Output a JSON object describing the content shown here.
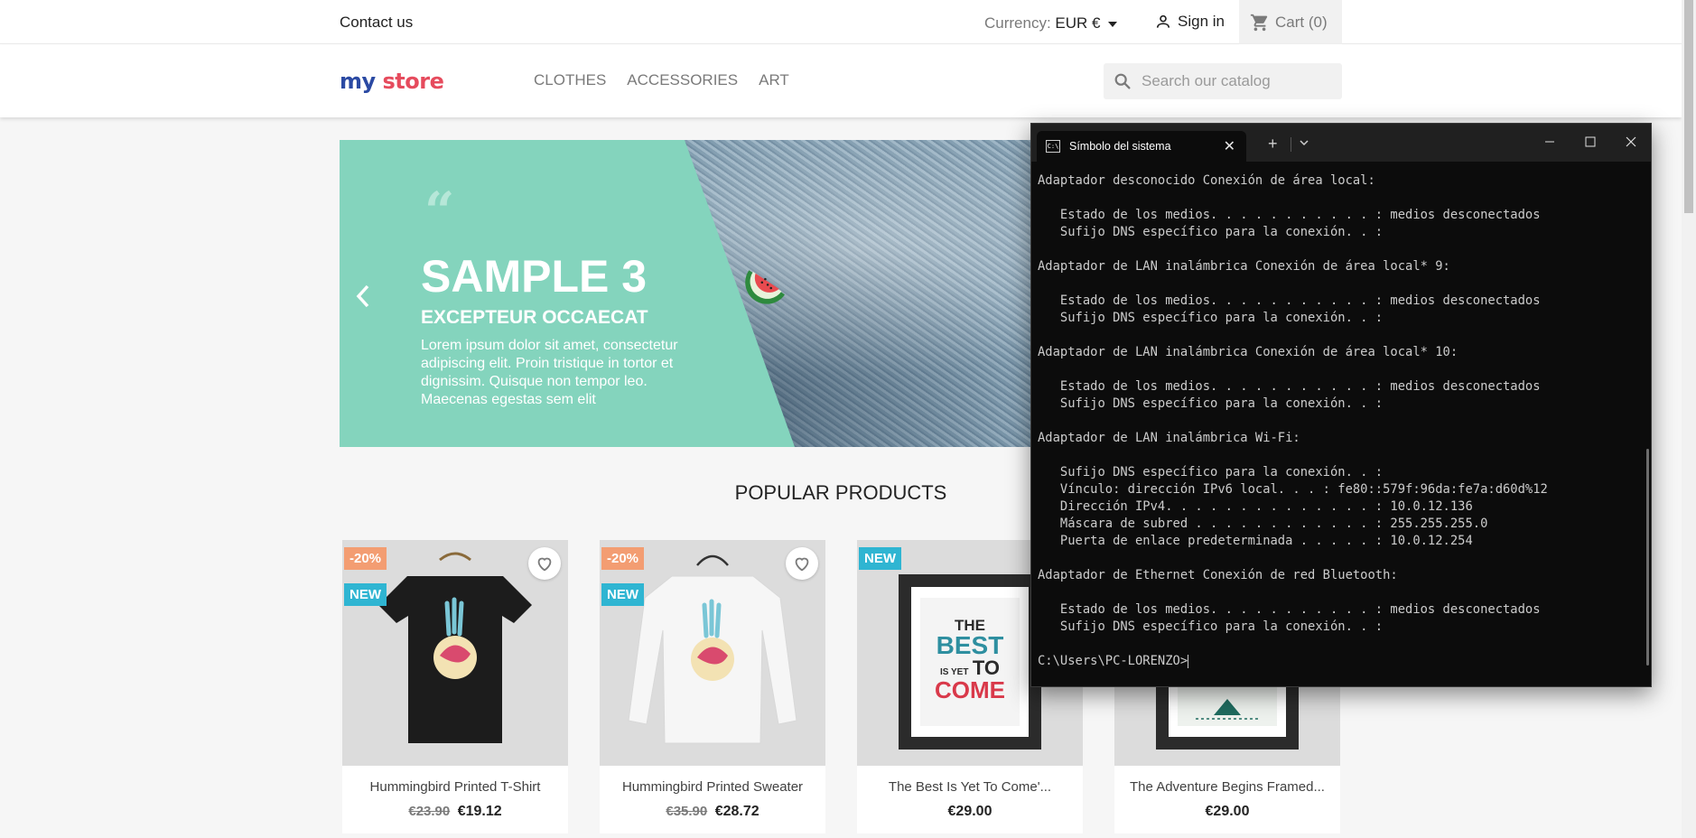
{
  "topbar": {
    "contact": "Contact us",
    "currency_label": "Currency:",
    "currency_value": "EUR €",
    "signin": "Sign in",
    "cart": "Cart (0)"
  },
  "header": {
    "logo": {
      "part1": "my",
      "part2": "store"
    },
    "nav": [
      "CLOTHES",
      "ACCESSORIES",
      "ART"
    ],
    "search_placeholder": "Search our catalog"
  },
  "hero": {
    "title": "SAMPLE 3",
    "subtitle": "EXCEPTEUR OCCAECAT",
    "description": "Lorem ipsum dolor sit amet, consectetur adipiscing elit. Proin tristique in tortor et dignissim. Quisque non tempor leo. Maecenas egestas sem elit"
  },
  "popular": {
    "title": "POPULAR PRODUCTS",
    "products": [
      {
        "name": "Hummingbird Printed T-Shirt",
        "old_price": "€23.90",
        "price": "€19.12",
        "discount": "-20%",
        "new": "NEW"
      },
      {
        "name": "Hummingbird Printed Sweater",
        "old_price": "€35.90",
        "price": "€28.72",
        "discount": "-20%",
        "new": "NEW"
      },
      {
        "name": "The Best Is Yet To Come'...",
        "price": "€29.00",
        "new": "NEW"
      },
      {
        "name": "The Adventure Begins Framed...",
        "price": "€29.00"
      }
    ],
    "poster_text": {
      "l1": "THE",
      "l2": "BEST",
      "l3": "IS YET",
      "l4": "TO",
      "l5": "COME"
    }
  },
  "terminal": {
    "tab_title": "Símbolo del sistema",
    "lines": [
      "Adaptador desconocido Conexión de área local:",
      "",
      "   Estado de los medios. . . . . . . . . . . : medios desconectados",
      "   Sufijo DNS específico para la conexión. . :",
      "",
      "Adaptador de LAN inalámbrica Conexión de área local* 9:",
      "",
      "   Estado de los medios. . . . . . . . . . . : medios desconectados",
      "   Sufijo DNS específico para la conexión. . :",
      "",
      "Adaptador de LAN inalámbrica Conexión de área local* 10:",
      "",
      "   Estado de los medios. . . . . . . . . . . : medios desconectados",
      "   Sufijo DNS específico para la conexión. . :",
      "",
      "Adaptador de LAN inalámbrica Wi-Fi:",
      "",
      "   Sufijo DNS específico para la conexión. . :",
      "   Vínculo: dirección IPv6 local. . . : fe80::579f:96da:fe7a:d60d%12",
      "   Dirección IPv4. . . . . . . . . . . . . . : 10.0.12.136",
      "   Máscara de subred . . . . . . . . . . . . : 255.255.255.0",
      "   Puerta de enlace predeterminada . . . . . : 10.0.12.254",
      "",
      "Adaptador de Ethernet Conexión de red Bluetooth:",
      "",
      "   Estado de los medios. . . . . . . . . . . : medios desconectados",
      "   Sufijo DNS específico para la conexión. . :",
      "",
      "C:\\Users\\PC-LORENZO>"
    ]
  },
  "colors": {
    "accent": "#2fb5d2",
    "discount": "#f39d72",
    "hero_mint": "#84d4bd",
    "terminal_bg": "#0c0c0c",
    "terminal_text": "#cccccc"
  },
  "icons": [
    "person-icon",
    "cart-icon",
    "search-icon",
    "heart-icon",
    "chevron-left-icon",
    "cmd-icon",
    "close-icon",
    "plus-icon",
    "chevron-down-icon",
    "minimize-icon",
    "maximize-icon"
  ]
}
